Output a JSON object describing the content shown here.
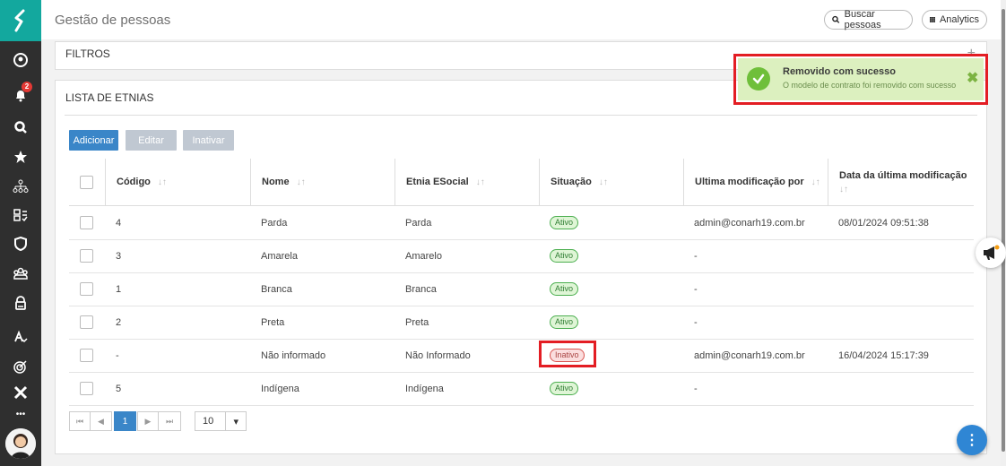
{
  "header": {
    "title": "Gestão de pessoas",
    "search_label": "Buscar pessoas",
    "analytics_label": "Analytics"
  },
  "sidebar": {
    "notification_count": "2",
    "more_label": "•••",
    "items": [
      "profile-icon",
      "bell-icon",
      "search-icon",
      "star-icon",
      "org-chart-icon",
      "team-icon",
      "shield-icon",
      "users-group-icon",
      "lock-icon",
      "user-check-icon",
      "target-icon",
      "x-icon"
    ]
  },
  "filters": {
    "title": "FILTROS",
    "toggle": "+"
  },
  "list": {
    "title": "LISTA DE ETNIAS",
    "buttons": {
      "add": "Adicionar",
      "edit": "Editar",
      "inactivate": "Inativar"
    },
    "columns": [
      "Código",
      "Nome",
      "Etnia ESocial",
      "Situação",
      "Ultima modificação por",
      "Data da última modificação"
    ],
    "sort_glyph": "↓↑",
    "rows": [
      {
        "code": "4",
        "name": "Parda",
        "esocial": "Parda",
        "status": "Ativo",
        "modified_by": "admin@conarh19.com.br",
        "modified_at": "08/01/2024 09:51:38"
      },
      {
        "code": "3",
        "name": "Amarela",
        "esocial": "Amarelo",
        "status": "Ativo",
        "modified_by": "-",
        "modified_at": ""
      },
      {
        "code": "1",
        "name": "Branca",
        "esocial": "Branca",
        "status": "Ativo",
        "modified_by": "-",
        "modified_at": ""
      },
      {
        "code": "2",
        "name": "Preta",
        "esocial": "Preta",
        "status": "Ativo",
        "modified_by": "-",
        "modified_at": ""
      },
      {
        "code": "-",
        "name": "Não informado",
        "esocial": "Não Informado",
        "status": "Inativo",
        "modified_by": "admin@conarh19.com.br",
        "modified_at": "16/04/2024 15:17:39"
      },
      {
        "code": "5",
        "name": "Indígena",
        "esocial": "Indígena",
        "status": "Ativo",
        "modified_by": "-",
        "modified_at": ""
      }
    ]
  },
  "pagination": {
    "first": "⏮",
    "prev": "◀",
    "current": "1",
    "next": "▶",
    "last": "⏭",
    "page_size": "10",
    "dropdown": "▾"
  },
  "toast": {
    "title": "Removido com sucesso",
    "message": "O modelo de contrato foi removido com sucesso",
    "close": "✖"
  },
  "fab_label": "⋮",
  "colors": {
    "teal": "#13a89e",
    "sidebar": "#2f2f2f",
    "primary": "#3a86c8",
    "highlight": "#e31d23"
  }
}
